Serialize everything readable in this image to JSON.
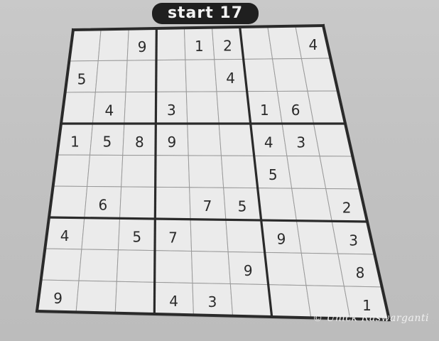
{
  "puzzle": {
    "title": "start 17",
    "grid": [
      [
        "",
        "",
        "9",
        "",
        "1",
        "2",
        "",
        "",
        "4"
      ],
      [
        "5",
        "",
        "",
        "",
        "",
        "4",
        "",
        "",
        ""
      ],
      [
        "",
        "4",
        "",
        "3",
        "",
        "",
        "1",
        "6",
        ""
      ],
      [
        "1",
        "5",
        "8",
        "9",
        "",
        "",
        "4",
        "3",
        ""
      ],
      [
        "",
        "",
        "",
        "",
        "",
        "",
        "5",
        "",
        ""
      ],
      [
        "",
        "6",
        "",
        "",
        "7",
        "5",
        "",
        "",
        "2"
      ],
      [
        "4",
        "",
        "5",
        "7",
        "",
        "",
        "9",
        "",
        "3"
      ],
      [
        "",
        "",
        "",
        "",
        "",
        "9",
        "",
        "",
        "8"
      ],
      [
        "9",
        "",
        "",
        "4",
        "3",
        "",
        "",
        "",
        "1"
      ]
    ]
  },
  "credit": "© Unick Raswarganti",
  "colors": {
    "page": "#c4c4c4",
    "cell": "#ebebeb",
    "line": "#2a2a2a",
    "title_bg": "#1f1f1f"
  }
}
